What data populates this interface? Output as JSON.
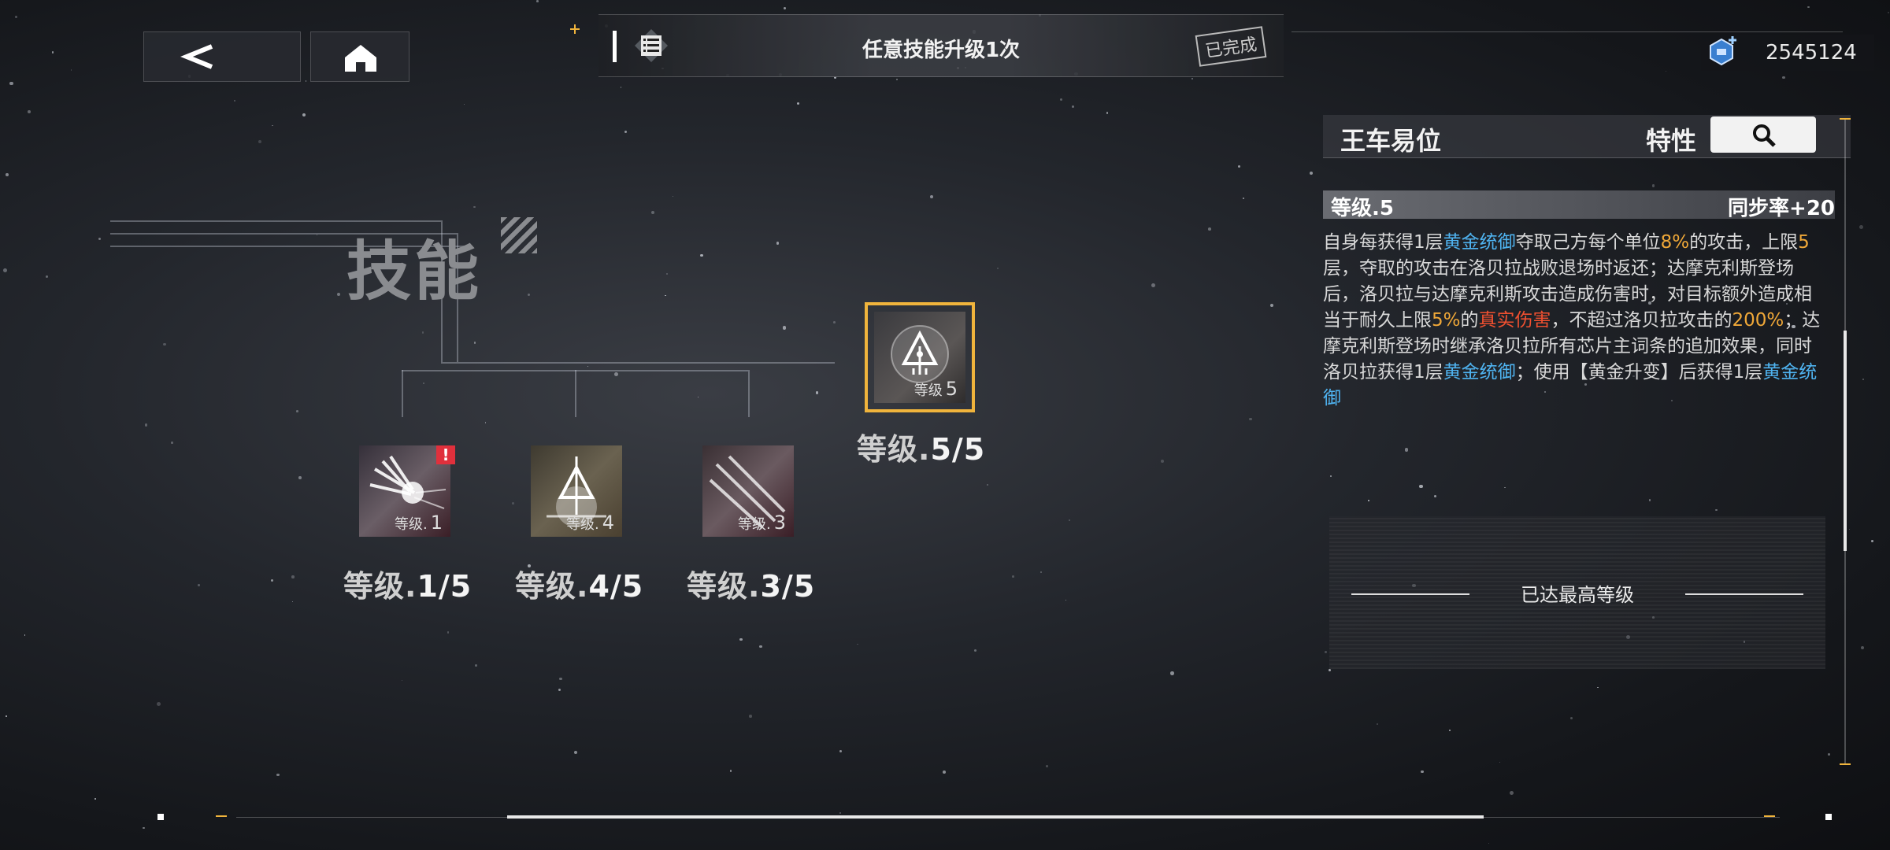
{
  "nav": {
    "back_icon": "chevron-left-icon",
    "home_icon": "home-icon"
  },
  "mission": {
    "text": "任意技能升级1次",
    "stamp": "已完成",
    "icon": "list-icon"
  },
  "currency": {
    "amount": "2545124",
    "icon": "crystal-plus-icon"
  },
  "section_title": "技能",
  "skills": [
    {
      "level_small_label": "等级.",
      "level_small": "1",
      "label_prefix": "等级.",
      "label_value": "1/5",
      "alert": "!"
    },
    {
      "level_small_label": "等级.",
      "level_small": "4",
      "label_prefix": "等级.",
      "label_value": "4/5"
    },
    {
      "level_small_label": "等级.",
      "level_small": "3",
      "label_prefix": "等级.",
      "label_value": "3/5"
    }
  ],
  "featured_skill": {
    "level_small_label": "等级",
    "level_small": "5",
    "label_prefix": "等级.",
    "label_value": "5/5"
  },
  "detail": {
    "name": "王车易位",
    "trait_label": "特性",
    "search_icon": "search-icon",
    "level": "等级.5",
    "sync": "同步率+20",
    "desc": [
      {
        "t": "自身每获得1层"
      },
      {
        "t": "黄金统御",
        "c": "blue"
      },
      {
        "t": "夺取己方每个单位"
      },
      {
        "t": "8%",
        "c": "orange"
      },
      {
        "t": "的攻击，上限"
      },
      {
        "t": "5",
        "c": "orange"
      },
      {
        "t": "层，夺取的攻击在洛贝拉战败退场时返还；达摩克利斯登场后，洛贝拉与达摩克利斯攻击造成伤害时，对目标额外造成相当于耐久上限"
      },
      {
        "t": "5%",
        "c": "orange"
      },
      {
        "t": "的"
      },
      {
        "t": "真实伤害",
        "c": "red"
      },
      {
        "t": "，不超过洛贝拉攻击的"
      },
      {
        "t": "200%",
        "c": "orange"
      },
      {
        "t": "；达摩克利斯登场时继承洛贝拉所有芯片主词条的追加效果，同时洛贝拉获得1层"
      },
      {
        "t": "黄金统御",
        "c": "blue"
      },
      {
        "t": "；使用【黄金升变】后获得1层"
      },
      {
        "t": "黄金统御",
        "c": "blue"
      }
    ],
    "max_level": "已达最高等级"
  },
  "colors": {
    "accent_yellow": "#f0b43c",
    "highlight_blue": "#4fb3f0",
    "highlight_orange": "#f0a838",
    "highlight_red": "#f05030",
    "alert_red": "#e0303c"
  }
}
